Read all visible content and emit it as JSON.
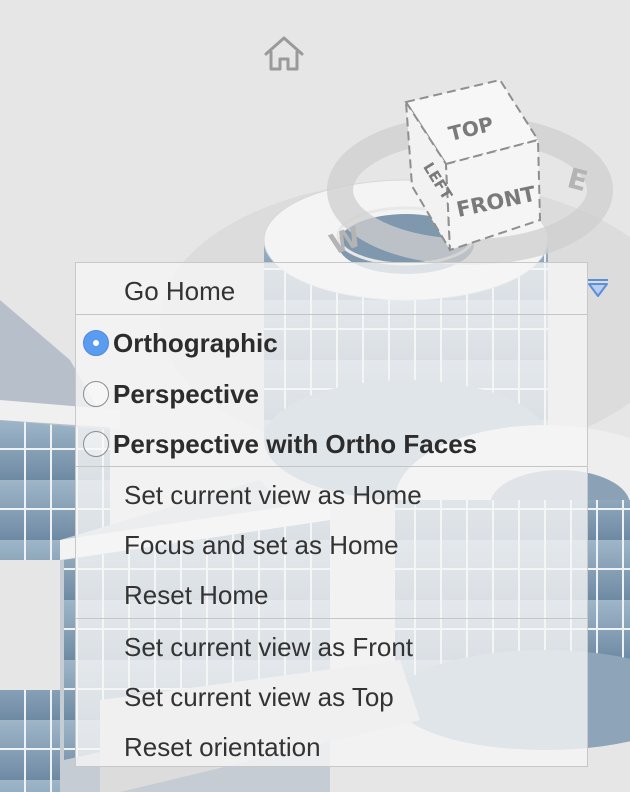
{
  "viewcube": {
    "faces": {
      "top": "TOP",
      "front": "FRONT",
      "left": "LEFT"
    },
    "compass": {
      "west": "W",
      "east": "E"
    }
  },
  "menu": {
    "go_home": "Go Home",
    "projection": [
      {
        "label": "Orthographic",
        "checked": true
      },
      {
        "label": "Perspective",
        "checked": false
      },
      {
        "label": "Perspective with Ortho Faces",
        "checked": false
      }
    ],
    "home_actions": [
      "Set current view as Home",
      "Focus and set as Home",
      "Reset Home"
    ],
    "orientation_actions": [
      "Set current view as Front",
      "Set current view as Top",
      "Reset orientation"
    ]
  },
  "icons": [
    "home-icon",
    "menu-arrow-icon",
    "radio-button-icon"
  ],
  "colors": {
    "radio_checked": "#5b9cf0",
    "menu_bg": "#f5f5f5",
    "viewcube_arrow": "#5b8fd8"
  }
}
